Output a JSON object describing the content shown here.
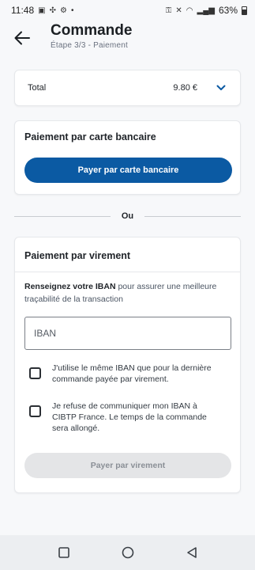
{
  "status_bar": {
    "time": "11:48",
    "battery": "63%"
  },
  "header": {
    "title": "Commande",
    "subtitle": "Étape 3/3 - Paiement"
  },
  "total": {
    "label": "Total",
    "amount": "9.80 €"
  },
  "carte": {
    "title": "Paiement par carte bancaire",
    "button_label": "Payer par carte bancaire"
  },
  "separator": {
    "label": "Ou"
  },
  "virement": {
    "title": "Paiement par virement",
    "info_bold": "Renseignez votre IBAN",
    "info_rest": " pour assurer une meilleure traçabilité de la transaction",
    "iban_placeholder": "IBAN",
    "option_same_iban": "J'utilise le même IBAN que pour la dernière commande payée par virement.",
    "option_refuse": "Je refuse de communiquer mon IBAN à CIBTP France. Le temps de la commande sera allongé.",
    "button_label": "Payer par virement"
  },
  "colors": {
    "primary": "#0b5aa3",
    "disabled_bg": "#e4e5e7",
    "disabled_text": "#8a8f96"
  },
  "icons": {
    "back": "arrow-left-icon",
    "expand": "chevron-down-icon",
    "nav_recents": "square-icon",
    "nav_home": "circle-icon",
    "nav_back": "triangle-back-icon"
  }
}
